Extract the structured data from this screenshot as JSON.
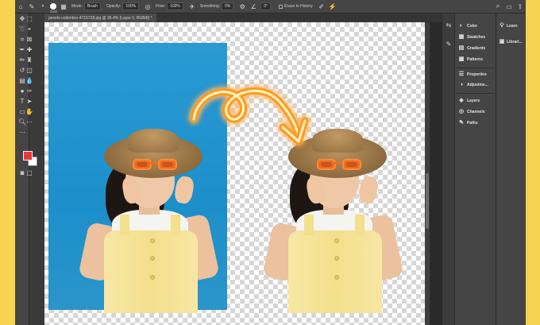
{
  "app": {
    "name": "Adobe Photoshop"
  },
  "options_bar": {
    "brush_size": "2000",
    "mode_label": "Mode:",
    "mode_value": "Brush",
    "opacity_label": "Opacity:",
    "opacity_value": "100%",
    "flow_label": "Flow:",
    "flow_value": "100%",
    "smoothing_label": "Smoothing:",
    "smoothing_value": "0%",
    "angle_value": "0°",
    "erase_history_label": "Erase to History"
  },
  "document_tab": {
    "title": "pexels-cottonbro-4715728.jpg @ 35.4% (Layer 0, RGB/8) *"
  },
  "panels_middle": [
    {
      "icon": "color-icon",
      "label": "Color"
    },
    {
      "icon": "swatches-icon",
      "label": "Swatches"
    },
    {
      "icon": "gradients-icon",
      "label": "Gradients"
    },
    {
      "icon": "patterns-icon",
      "label": "Patterns"
    },
    {
      "icon": "properties-icon",
      "label": "Properties"
    },
    {
      "icon": "adjustments-icon",
      "label": "Adjustme..."
    },
    {
      "icon": "layers-icon",
      "label": "Layers"
    },
    {
      "icon": "channels-icon",
      "label": "Channels"
    },
    {
      "icon": "paths-icon",
      "label": "Paths"
    }
  ],
  "panels_right": [
    {
      "icon": "learn-icon",
      "label": "Learn"
    },
    {
      "icon": "libraries-icon",
      "label": "Librari..."
    }
  ],
  "colors": {
    "foreground": "#e23a3a",
    "background": "#ffffff",
    "accent_glow": "#ff9a1a",
    "page_border": "#f7d44f"
  }
}
